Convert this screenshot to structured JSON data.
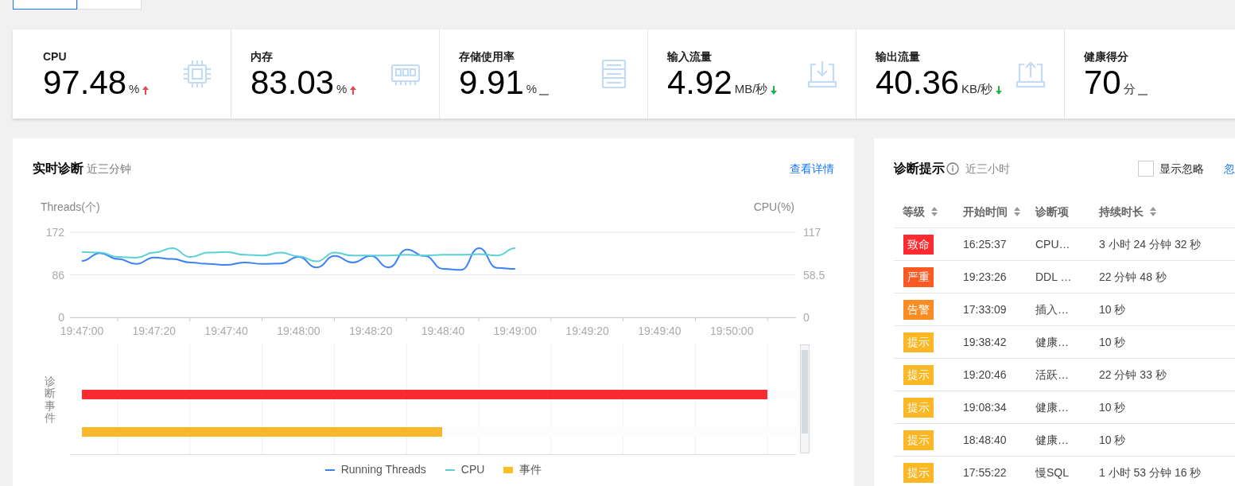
{
  "tabs": [
    {
      "selected": true
    },
    {
      "selected": false
    }
  ],
  "stats": [
    {
      "label": "CPU",
      "value": "97.48",
      "unit": "%",
      "kind": "up"
    },
    {
      "label": "内存",
      "value": "83.03",
      "unit": "%",
      "kind": "up"
    },
    {
      "label": "存储使用率",
      "value": "9.91",
      "unit": "%",
      "kind": "flat"
    },
    {
      "label": "输入流量",
      "value": "4.92",
      "unit": "MB/秒",
      "kind": "down"
    },
    {
      "label": "输出流量",
      "value": "40.36",
      "unit": "KB/秒",
      "kind": "down"
    },
    {
      "label": "健康得分",
      "value": "70",
      "unit": "分",
      "kind": "flat"
    }
  ],
  "realtime": {
    "title": "实时诊断",
    "subtitle": "近三分钟",
    "link": "查看详情",
    "chart_data": {
      "type": "line",
      "ylabel": "Threads(个)",
      "y2label": "CPU(%)",
      "categories": [
        "19:47:00",
        null,
        null,
        null,
        "19:47:20",
        null,
        null,
        null,
        "19:47:40",
        null,
        null,
        null,
        "19:48:00",
        null,
        null,
        null,
        "19:48:20",
        null,
        null,
        null,
        "19:48:40",
        null,
        null,
        null,
        "19:49:00",
        null,
        null,
        null,
        "19:49:20",
        null,
        null,
        null,
        "19:49:40",
        null,
        null,
        null,
        "19:50:00"
      ],
      "series": [
        {
          "name": "Running Threads",
          "color": "#3b82f6",
          "values": [
            114,
            130,
            118,
            108,
            121,
            118,
            111,
            108,
            106,
            111,
            108,
            109,
            122,
            101,
            124,
            111,
            124,
            101,
            137,
            124,
            98,
            96,
            140,
            100,
            98,
            null,
            null,
            null,
            null,
            null,
            null,
            null,
            null,
            null,
            null,
            null,
            null
          ]
        },
        {
          "name": "CPU",
          "color": "#5bd1d7",
          "axis": "y2",
          "values": [
            90,
            89,
            83,
            82,
            89,
            95,
            83,
            89,
            90,
            86,
            85,
            89,
            84,
            77,
            89,
            85,
            85,
            85,
            86,
            85,
            86,
            86,
            87,
            85,
            95,
            null,
            null,
            null,
            null,
            null,
            null,
            null,
            null,
            null,
            null,
            null,
            null
          ]
        }
      ],
      "ylim": [
        0,
        172
      ],
      "y2lim": [
        0,
        117
      ],
      "yticks": [
        0,
        86,
        172
      ],
      "y2ticks": [
        {
          "value": 0,
          "label": "0"
        },
        {
          "value": 58.5,
          "label": "58.5"
        },
        {
          "value": 117,
          "label": "117"
        }
      ]
    },
    "events": {
      "ylabel": "诊断事件",
      "name": "事件",
      "color": "#fbbf24",
      "bars": [
        {
          "color": "#fd2a2f",
          "level": 0.96
        },
        {
          "color": "#f9b72c",
          "level": 0.505
        }
      ]
    }
  },
  "tips": {
    "title": "诊断提示",
    "subtitle": "近三小时",
    "show_ignored": {
      "label": "显示忽略",
      "checked": false
    },
    "link": "忽",
    "columns": [
      {
        "label": "等级",
        "sortable": true
      },
      {
        "label": "开始时间",
        "sortable": true
      },
      {
        "label": "诊断项",
        "sortable": false
      },
      {
        "label": "持续时长",
        "sortable": true
      }
    ],
    "rows": [
      {
        "level": "致命",
        "color": "#fd2a2f",
        "time": "16:25:37",
        "item": "CPU…",
        "duration": "3 小时 24 分钟 32 秒"
      },
      {
        "level": "严重",
        "color": "#fb5a24",
        "time": "19:23:26",
        "item": "DDL …",
        "duration": "22 分钟 48 秒"
      },
      {
        "level": "告警",
        "color": "#fb8c24",
        "time": "17:33:09",
        "item": "插入…",
        "duration": "10 秒"
      },
      {
        "level": "提示",
        "color": "#fbb724",
        "time": "19:38:42",
        "item": "健康…",
        "duration": "10 秒"
      },
      {
        "level": "提示",
        "color": "#fbb724",
        "time": "19:20:46",
        "item": "活跃…",
        "duration": "22 分钟 33 秒"
      },
      {
        "level": "提示",
        "color": "#fbb724",
        "time": "19:08:34",
        "item": "健康…",
        "duration": "10 秒"
      },
      {
        "level": "提示",
        "color": "#fbb724",
        "time": "18:48:40",
        "item": "健康…",
        "duration": "10 秒"
      },
      {
        "level": "提示",
        "color": "#fbb724",
        "time": "17:55:22",
        "item": "慢SQL",
        "duration": "1 小时 53 分钟 16 秒"
      }
    ]
  }
}
